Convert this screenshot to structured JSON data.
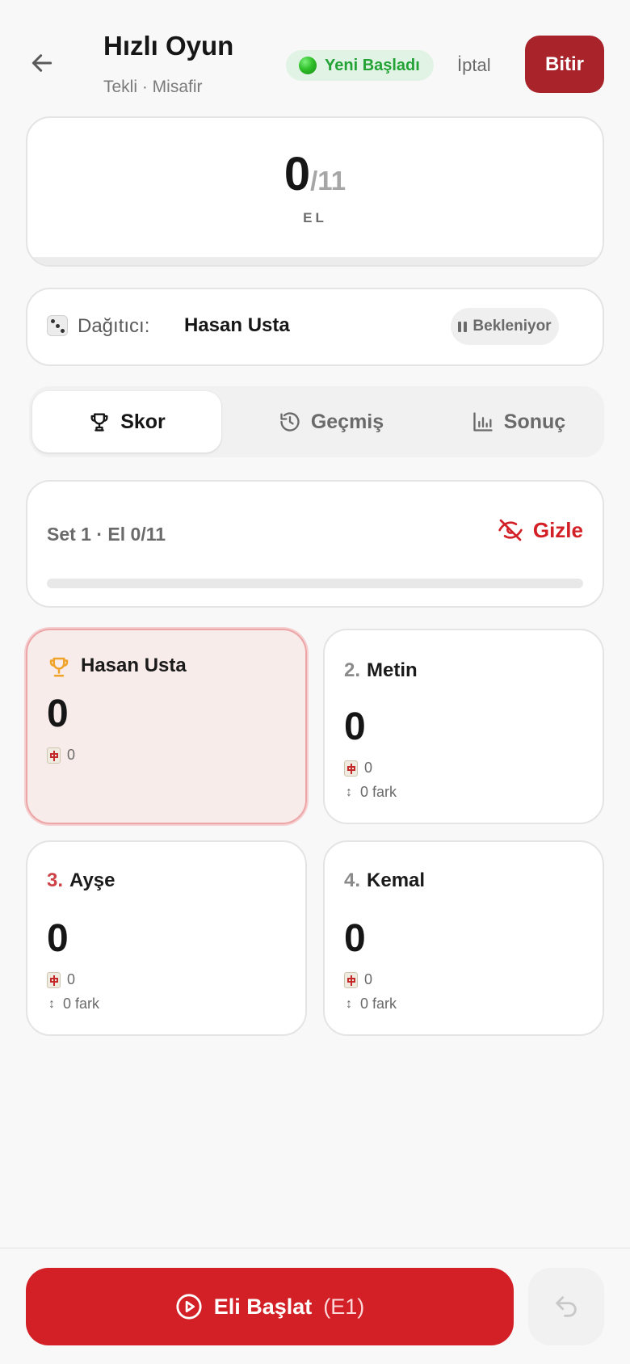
{
  "header": {
    "title": "Hızlı Oyun",
    "subtitle": "Tekli · Misafir",
    "status": "Yeni Başladı",
    "cancel_label": "İptal",
    "finish_label": "Bitir"
  },
  "round": {
    "current": "0",
    "total": "/11",
    "label": "EL"
  },
  "dealer": {
    "label": "Dağıtıcı:",
    "name": "Hasan Usta",
    "status": "Bekleniyor"
  },
  "tabs": [
    {
      "label": "Skor",
      "active": true
    },
    {
      "label": "Geçmiş",
      "active": false
    },
    {
      "label": "Sonuç",
      "active": false
    }
  ],
  "progress": {
    "label": "Set 1 · El 0/11",
    "toggle_label": "Gizle",
    "fraction": 0
  },
  "players": [
    {
      "rank": "",
      "name": "Hasan Usta",
      "score": "0",
      "tiles": "0",
      "diff": ""
    },
    {
      "rank": "2.",
      "name": "Metin",
      "score": "0",
      "tiles": "0",
      "diff": "0 fark"
    },
    {
      "rank": "3.",
      "name": "Ayşe",
      "score": "0",
      "tiles": "0",
      "diff": "0 fark"
    },
    {
      "rank": "4.",
      "name": "Kemal",
      "score": "0",
      "tiles": "0",
      "diff": "0 fark"
    }
  ],
  "actions": {
    "start_label": "Eli Başlat",
    "start_shortcut": "(E1)"
  },
  "colors": {
    "accent": "#d32026",
    "finish": "#a8242a",
    "status_green": "#23a236"
  }
}
